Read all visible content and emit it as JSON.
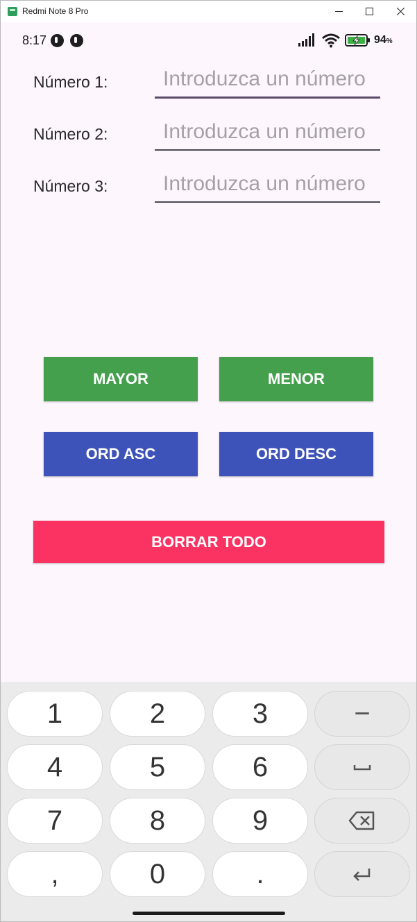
{
  "window": {
    "title": "Redmi Note 8 Pro"
  },
  "status_bar": {
    "time": "8:17",
    "battery_percent": "94",
    "battery_unit": "%"
  },
  "form": {
    "fields": [
      {
        "label": "Número 1:",
        "placeholder": "Introduzca un número",
        "value": ""
      },
      {
        "label": "Número 2:",
        "placeholder": "Introduzca un número",
        "value": ""
      },
      {
        "label": "Número 3:",
        "placeholder": "Introduzca un número",
        "value": ""
      }
    ]
  },
  "buttons": {
    "mayor": "MAYOR",
    "menor": "MENOR",
    "ord_asc": "ORD ASC",
    "ord_desc": "ORD DESC",
    "borrar_todo": "BORRAR TODO"
  },
  "colors": {
    "green": "#44a04d",
    "blue": "#3e53b9",
    "red": "#fb3363",
    "background": "#fdf6fd"
  },
  "keyboard": {
    "keys": [
      "1",
      "2",
      "3",
      "−",
      "4",
      "5",
      "6",
      "space-icon",
      "7",
      "8",
      "9",
      "backspace-icon",
      ",",
      "0",
      ".",
      "enter-icon"
    ],
    "labels": {
      "k1": "1",
      "k2": "2",
      "k3": "3",
      "minus": "−",
      "k4": "4",
      "k5": "5",
      "k6": "6",
      "k7": "7",
      "k8": "8",
      "k9": "9",
      "comma": ",",
      "k0": "0",
      "period": "."
    }
  }
}
